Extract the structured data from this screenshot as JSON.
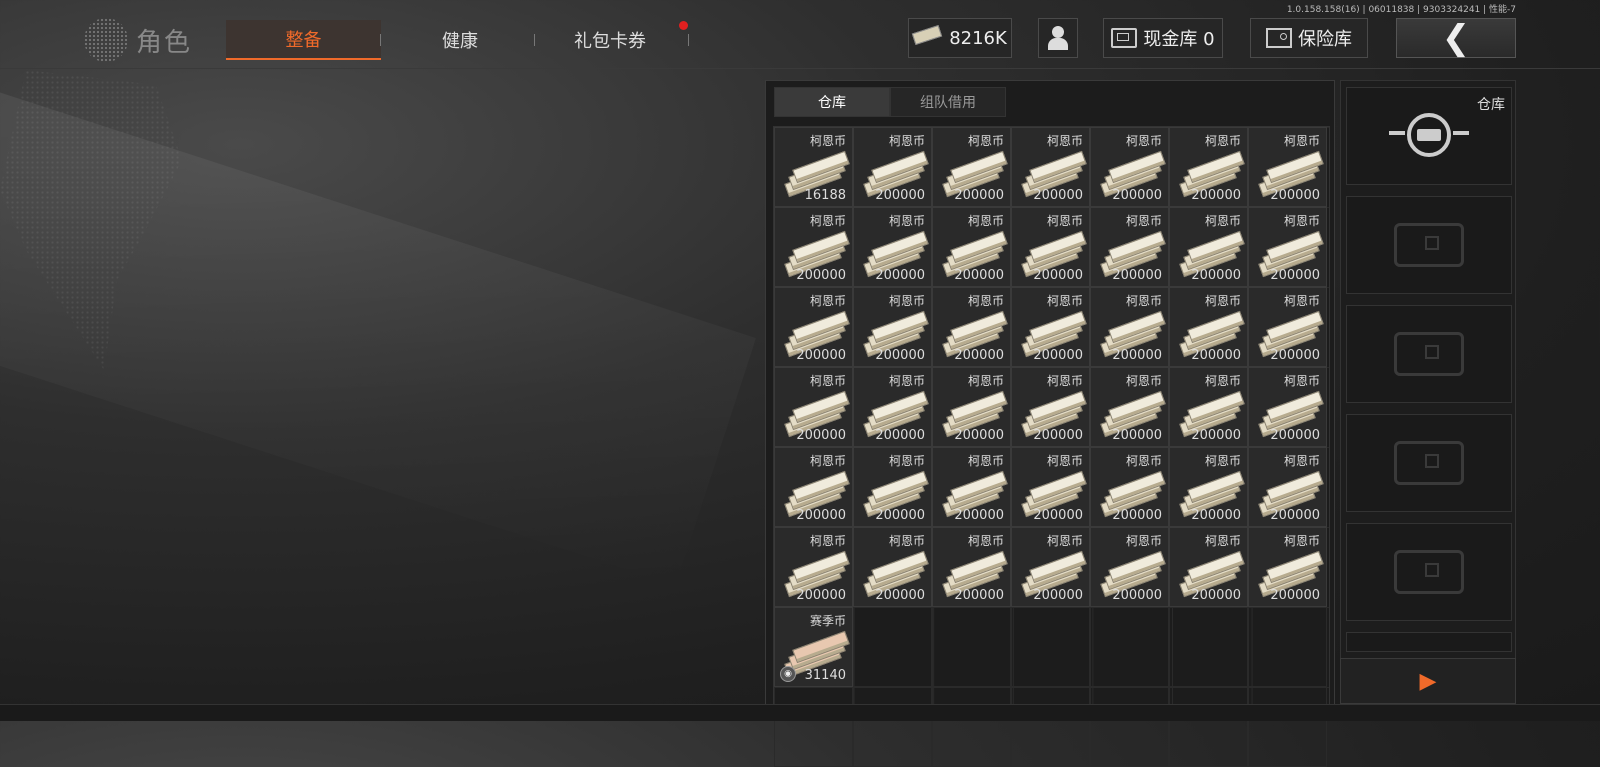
{
  "version": "1.0.158.158(16) | 06011838 | 9303324241 | 性能-7",
  "header": {
    "role_label": "角色",
    "tabs": [
      {
        "label": "整备",
        "active": true
      },
      {
        "label": "健康",
        "active": false
      },
      {
        "label": "礼包卡券",
        "active": false,
        "notification": true
      }
    ],
    "currency_value": "8216K",
    "cash_vault_label": "现金库 0",
    "safe_label": "保险库",
    "accent_color": "#f06a2a"
  },
  "storage": {
    "tabs": [
      {
        "label": "仓库",
        "active": true
      },
      {
        "label": "组队借用",
        "active": false
      }
    ],
    "items": [
      {
        "name": "柯恩币",
        "qty": "16188"
      },
      {
        "name": "柯恩币",
        "qty": "200000"
      },
      {
        "name": "柯恩币",
        "qty": "200000"
      },
      {
        "name": "柯恩币",
        "qty": "200000"
      },
      {
        "name": "柯恩币",
        "qty": "200000"
      },
      {
        "name": "柯恩币",
        "qty": "200000"
      },
      {
        "name": "柯恩币",
        "qty": "200000"
      },
      {
        "name": "柯恩币",
        "qty": "200000"
      },
      {
        "name": "柯恩币",
        "qty": "200000"
      },
      {
        "name": "柯恩币",
        "qty": "200000"
      },
      {
        "name": "柯恩币",
        "qty": "200000"
      },
      {
        "name": "柯恩币",
        "qty": "200000"
      },
      {
        "name": "柯恩币",
        "qty": "200000"
      },
      {
        "name": "柯恩币",
        "qty": "200000"
      },
      {
        "name": "柯恩币",
        "qty": "200000"
      },
      {
        "name": "柯恩币",
        "qty": "200000"
      },
      {
        "name": "柯恩币",
        "qty": "200000"
      },
      {
        "name": "柯恩币",
        "qty": "200000"
      },
      {
        "name": "柯恩币",
        "qty": "200000"
      },
      {
        "name": "柯恩币",
        "qty": "200000"
      },
      {
        "name": "柯恩币",
        "qty": "200000"
      },
      {
        "name": "柯恩币",
        "qty": "200000"
      },
      {
        "name": "柯恩币",
        "qty": "200000"
      },
      {
        "name": "柯恩币",
        "qty": "200000"
      },
      {
        "name": "柯恩币",
        "qty": "200000"
      },
      {
        "name": "柯恩币",
        "qty": "200000"
      },
      {
        "name": "柯恩币",
        "qty": "200000"
      },
      {
        "name": "柯恩币",
        "qty": "200000"
      },
      {
        "name": "柯恩币",
        "qty": "200000"
      },
      {
        "name": "柯恩币",
        "qty": "200000"
      },
      {
        "name": "柯恩币",
        "qty": "200000"
      },
      {
        "name": "柯恩币",
        "qty": "200000"
      },
      {
        "name": "柯恩币",
        "qty": "200000"
      },
      {
        "name": "柯恩币",
        "qty": "200000"
      },
      {
        "name": "柯恩币",
        "qty": "200000"
      },
      {
        "name": "柯恩币",
        "qty": "200000"
      },
      {
        "name": "柯恩币",
        "qty": "200000"
      },
      {
        "name": "柯恩币",
        "qty": "200000"
      },
      {
        "name": "柯恩币",
        "qty": "200000"
      },
      {
        "name": "柯恩币",
        "qty": "200000"
      },
      {
        "name": "柯恩币",
        "qty": "200000"
      },
      {
        "name": "柯恩币",
        "qty": "200000"
      },
      {
        "name": "赛季币",
        "qty": "31140",
        "season": true
      }
    ],
    "empty_slots": 13
  },
  "side": {
    "warehouse_label": "仓库",
    "locked_slots": 4,
    "next_icon": "arrow-right-icon"
  }
}
